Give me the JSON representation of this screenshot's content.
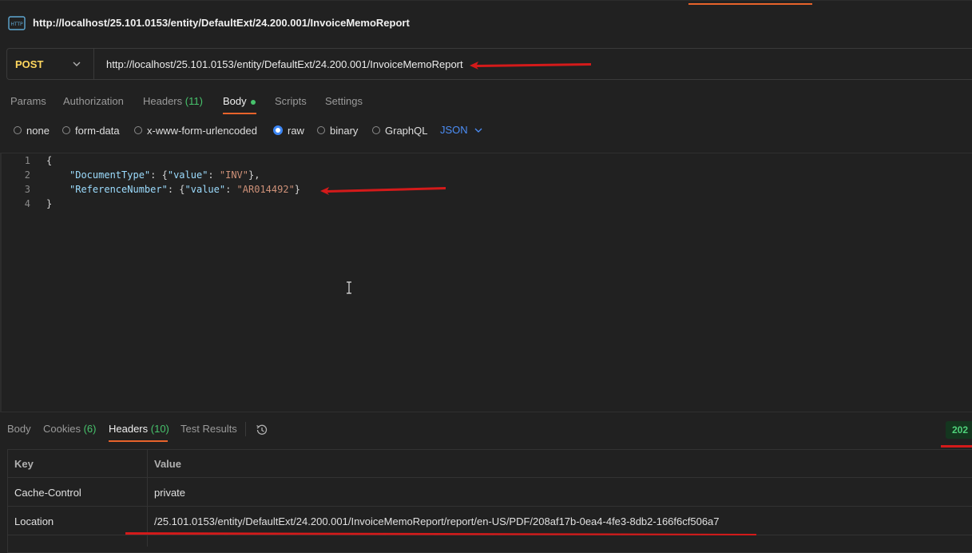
{
  "titlebar": {
    "title": "http://localhost/25.101.0153/entity/DefaultExt/24.200.001/InvoiceMemoReport",
    "icon": "http-icon"
  },
  "request": {
    "method": "POST",
    "url": "http://localhost/25.101.0153/entity/DefaultExt/24.200.001/InvoiceMemoReport"
  },
  "request_tabs": {
    "params": "Params",
    "authorization": "Authorization",
    "headers": "Headers",
    "headers_count": "(11)",
    "body": "Body",
    "scripts": "Scripts",
    "settings": "Settings"
  },
  "body_types": {
    "none": "none",
    "form_data": "form-data",
    "urlencoded": "x-www-form-urlencoded",
    "raw": "raw",
    "binary": "binary",
    "graphql": "GraphQL",
    "format": "JSON",
    "selected": "raw"
  },
  "editor": {
    "line_numbers": [
      "1",
      "2",
      "3",
      "4"
    ],
    "line1": "{",
    "line2_key": "\"DocumentType\"",
    "line2_mid": ": {",
    "line2_vkey": "\"value\"",
    "line2_colon": ": ",
    "line2_val": "\"INV\"",
    "line2_end": "},",
    "line3_key": "\"ReferenceNumber\"",
    "line3_mid": ": {",
    "line3_vkey": "\"value\"",
    "line3_colon": ": ",
    "line3_val": "\"AR014492\"",
    "line3_end": "}",
    "line4": "}"
  },
  "response_tabs": {
    "body": "Body",
    "cookies": "Cookies",
    "cookies_count": "(6)",
    "headers": "Headers",
    "headers_count": "(10)",
    "test_results": "Test Results"
  },
  "status": {
    "code": "202"
  },
  "response_headers": {
    "col_key": "Key",
    "col_value": "Value",
    "rows": [
      {
        "key": "Cache-Control",
        "value": "private"
      },
      {
        "key": "Location",
        "value": "/25.101.0153/entity/DefaultExt/24.200.001/InvoiceMemoReport/report/en-US/PDF/208af17b-0ea4-4fe3-8db2-166f6cf506a7"
      }
    ]
  },
  "colors": {
    "accent": "#e8632b",
    "method": "#ffd75e",
    "success": "#47c36c",
    "link": "#4c8ef7",
    "annotation": "#d41a1a"
  }
}
